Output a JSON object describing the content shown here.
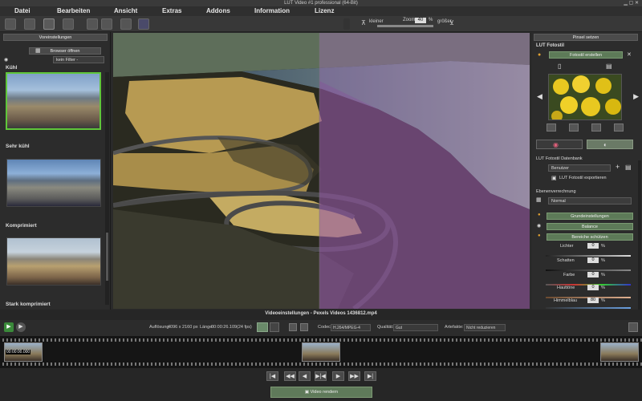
{
  "window": {
    "title": "LUT Video #1 professional (64-Bit)"
  },
  "menu": [
    "Datei",
    "Bearbeiten",
    "Ansicht",
    "Extras",
    "Addons",
    "Information",
    "Lizenz"
  ],
  "toolbar": {
    "zoom_label": "Zoom",
    "zoom_value": "40",
    "zoom_unit": "%",
    "smaller_label": "kleiner",
    "larger_label": "größer"
  },
  "left_panel": {
    "header": "Voreinstellungen",
    "open_browser": "Browser öffnen",
    "filter_placeholder": "kein Filter -",
    "presets": [
      "Kühl",
      "Sehr kühl",
      "Komprimiert",
      "Stark komprimiert"
    ]
  },
  "right_panel": {
    "header": "Pinsel setzen",
    "lut_title": "LUT Fotostil",
    "create_lut": "Fotostil erstellen",
    "database_label": "LUT Fotostil Datenbank",
    "database_value": "Benutzer",
    "export": "LUT Fotostil exportieren",
    "blend_label": "Ebenenverrechnung",
    "blend_value": "Normal",
    "sections": [
      "Grundeinstellungen",
      "Balance",
      "Bereiche schützen"
    ],
    "sliders": [
      {
        "label": "Lichter",
        "value": "0",
        "unit": "%"
      },
      {
        "label": "Schatten",
        "value": "0",
        "unit": "%"
      },
      {
        "label": "Farbe",
        "value": "0",
        "unit": "%"
      },
      {
        "label": "Hauttöne",
        "value": "0",
        "unit": "%"
      },
      {
        "label": "Himmelblau",
        "value": "80",
        "unit": "%"
      }
    ]
  },
  "status": {
    "title": "Videoeinstellungen - Pexels Videos 1436812.mp4",
    "resolution_label": "Auflösung:",
    "resolution_value": "4096 x 2160 px",
    "length_label": "Länge:",
    "length_value": "00:00:26.109",
    "fps_value": "(24 fps)",
    "codec_label": "Codec:",
    "codec_value": "H.264/MPEG-4",
    "quality_label": "Qualität:",
    "quality_value": "Gut",
    "artifacts_label": "Artefakte:",
    "artifacts_value": "Nicht reduzieren"
  },
  "timeline": {
    "timecode": "00:00:00.000"
  },
  "render_button": "Video rendern",
  "colors": {
    "accent_green": "#5fc63a",
    "panel_bg": "#2c2c2c"
  }
}
